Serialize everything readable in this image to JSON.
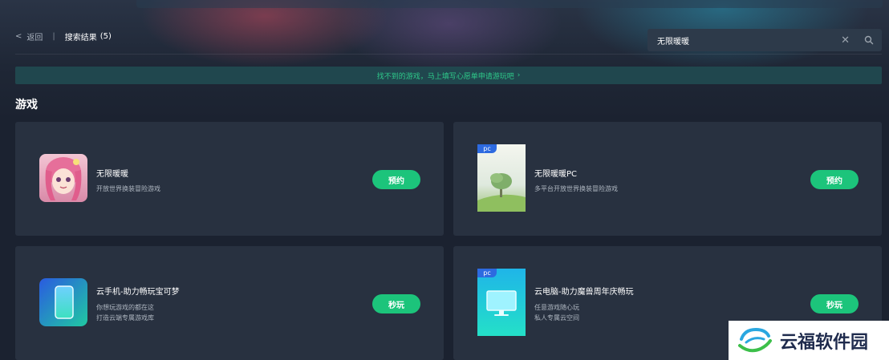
{
  "nav": {
    "back_chevron": "<",
    "back_label": "返回",
    "separator": "|",
    "result_title": "搜索结果",
    "result_count": "(5)"
  },
  "search": {
    "value": "无限暖暖",
    "clear_icon": "✕",
    "icon": "search-icon"
  },
  "banner": {
    "text": "找不到的游戏，马上填写心愿单申请游玩吧",
    "chevron": "›"
  },
  "section_title": "游戏",
  "cards": [
    {
      "name": "无限暖暖",
      "desc": [
        "开放世界换装冒险游戏"
      ],
      "button": "预约",
      "tag": ""
    },
    {
      "name": "无限暖暖PC",
      "desc": [
        "多平台开放世界换装冒险游戏"
      ],
      "button": "预约",
      "tag": "pc"
    },
    {
      "name": "云手机-助力畅玩宝可梦",
      "desc": [
        "你想玩游戏的都在这",
        "打造云端专属游戏库"
      ],
      "button": "秒玩",
      "tag": ""
    },
    {
      "name": "云电脑-助力魔兽周年庆畅玩",
      "desc": [
        "任意游戏随心玩",
        "私人专属云空间"
      ],
      "button": "秒玩",
      "tag": "pc"
    }
  ],
  "watermark": {
    "text": "云福软件园"
  },
  "colors": {
    "accent": "#1cc47b",
    "banner_text": "#2ec98a",
    "card_bg": "#283140",
    "pc_tag": "#2d6ae0"
  }
}
